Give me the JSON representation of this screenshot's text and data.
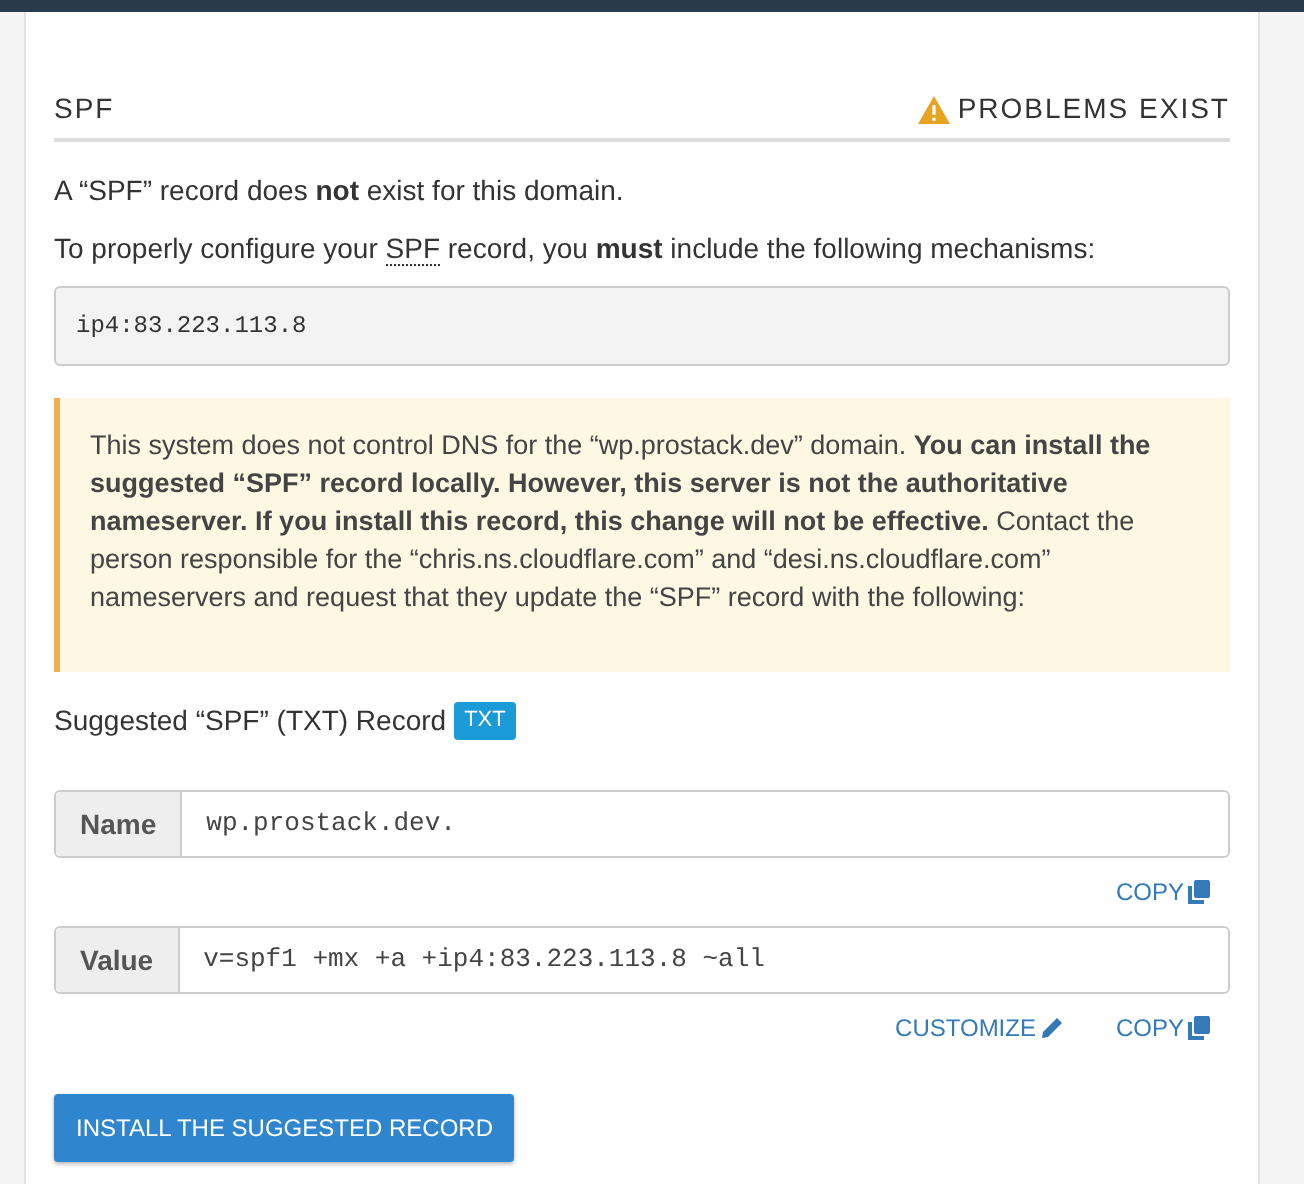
{
  "section": {
    "title": "SPF",
    "status": "PROBLEMS EXIST"
  },
  "intro": "A “SPF” record does **not** exist for this domain.",
  "instruction": {
    "before": "To properly configure your ",
    "abbr": "SPF",
    "after": " record, you **must** include the following mechanisms:"
  },
  "mechanisms": "ip4:83.223.113.8",
  "warning": "This system does not control DNS for the “wp.prostack.dev” domain. **You can install the suggested “SPF” record locally. However, this server is not the authoritative nameserver. If you install this record, this change will not be effective.** Contact the person responsible for the “chris.ns.cloudflare.com” and “desi.ns.cloudflare.com” nameservers and request that they update the “SPF” record with the following:",
  "suggested": {
    "label": "Suggested “SPF” (TXT) Record",
    "badge": "TXT"
  },
  "fields": [
    {
      "label": "Name",
      "value": "wp.prostack.dev.",
      "actions": [
        {
          "kind": "copy",
          "label": "COPY"
        }
      ]
    },
    {
      "label": "Value",
      "value": "v=spf1 +mx +a +ip4:83.223.113.8 ~all",
      "actions": [
        {
          "kind": "edit",
          "label": "CUSTOMIZE"
        },
        {
          "kind": "copy",
          "label": "COPY"
        }
      ]
    }
  ],
  "install_button": "INSTALL THE SUGGESTED RECORD"
}
